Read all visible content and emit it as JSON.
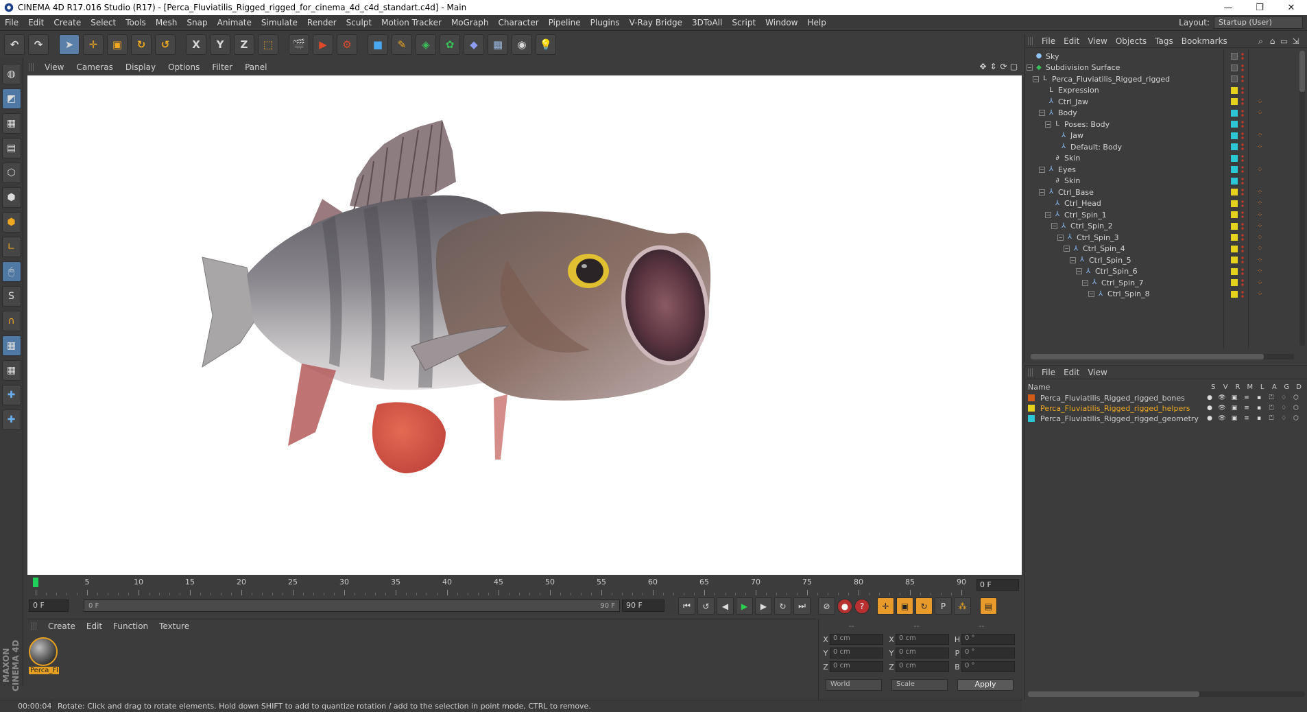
{
  "window": {
    "title": "CINEMA 4D R17.016 Studio (R17) - [Perca_Fluviatilis_Rigged_rigged_for_cinema_4d_c4d_standart.c4d] - Main",
    "minimize": "—",
    "maximize": "❐",
    "close": "✕"
  },
  "menubar": {
    "items": [
      "File",
      "Edit",
      "Create",
      "Select",
      "Tools",
      "Mesh",
      "Snap",
      "Animate",
      "Simulate",
      "Render",
      "Sculpt",
      "Motion Tracker",
      "MoGraph",
      "Character",
      "Pipeline",
      "Plugins",
      "V-Ray Bridge",
      "3DToAll",
      "Script",
      "Window",
      "Help"
    ],
    "layout_label": "Layout:",
    "layout_value": "Startup (User)"
  },
  "toolbar": {
    "icons": [
      "undo-icon",
      "redo-icon",
      "select-icon",
      "move-icon",
      "scale-icon",
      "rotate-icon",
      "recent-icon",
      "x-axis-icon",
      "y-axis-icon",
      "z-axis-icon",
      "world-coord-icon",
      "render-view-icon",
      "render-picture-icon",
      "render-settings-icon",
      "cube-icon",
      "pen-icon",
      "subdivision-icon",
      "cloner-icon",
      "deformer-icon",
      "floor-icon",
      "camera-icon",
      "light-icon"
    ],
    "x": "X",
    "y": "Y",
    "z": "Z"
  },
  "viewport": {
    "menu": [
      "View",
      "Cameras",
      "Display",
      "Options",
      "Filter",
      "Panel"
    ]
  },
  "timeline": {
    "ticks": [
      "0",
      "5",
      "10",
      "15",
      "20",
      "25",
      "30",
      "35",
      "40",
      "45",
      "50",
      "55",
      "60",
      "65",
      "70",
      "75",
      "80",
      "85",
      "90"
    ],
    "current_frame": "0 F"
  },
  "playback": {
    "start_field": "0 F",
    "range_start": "0 F",
    "range_end": "90 F",
    "end_field": "90 F"
  },
  "material_manager": {
    "menu": [
      "Create",
      "Edit",
      "Function",
      "Texture"
    ],
    "material_name": "Perca_Fl"
  },
  "maxon_logo": "MAXON CINEMA 4D",
  "coordinates": {
    "headers": [
      "--",
      "--",
      "--"
    ],
    "rows": [
      {
        "a": "X",
        "av": "0 cm",
        "b": "X",
        "bv": "0 cm",
        "c": "H",
        "cv": "0 °"
      },
      {
        "a": "Y",
        "av": "0 cm",
        "b": "Y",
        "bv": "0 cm",
        "c": "P",
        "cv": "0 °"
      },
      {
        "a": "Z",
        "av": "0 cm",
        "b": "Z",
        "bv": "0 cm",
        "c": "B",
        "cv": "0 °"
      }
    ],
    "space": "World",
    "mode": "Scale",
    "apply": "Apply"
  },
  "statusbar": {
    "time": "00:00:04",
    "message": "Rotate: Click and drag to rotate elements. Hold down SHIFT to add to quantize rotation / add to the selection in point mode, CTRL to remove."
  },
  "object_manager": {
    "menu": [
      "File",
      "Edit",
      "View",
      "Objects",
      "Tags",
      "Bookmarks"
    ],
    "objects": [
      {
        "name": "Sky",
        "depth": 0,
        "icon": "sky",
        "color": "none"
      },
      {
        "name": "Subdivision Surface",
        "depth": 0,
        "icon": "subdiv",
        "color": "none"
      },
      {
        "name": "Perca_Fluviatilis_Rigged_rigged",
        "depth": 1,
        "icon": "null",
        "color": "none"
      },
      {
        "name": "Expression",
        "depth": 2,
        "icon": "null",
        "color": "yellow"
      },
      {
        "name": "Ctrl_Jaw",
        "depth": 2,
        "icon": "joint",
        "color": "yellow"
      },
      {
        "name": "Body",
        "depth": 2,
        "icon": "joint",
        "color": "cyan"
      },
      {
        "name": "Poses: Body",
        "depth": 3,
        "icon": "null",
        "color": "cyan"
      },
      {
        "name": "Jaw",
        "depth": 4,
        "icon": "joint",
        "color": "cyan"
      },
      {
        "name": "Default: Body",
        "depth": 4,
        "icon": "joint",
        "color": "cyan"
      },
      {
        "name": "Skin",
        "depth": 3,
        "icon": "skin",
        "color": "cyan"
      },
      {
        "name": "Eyes",
        "depth": 2,
        "icon": "joint",
        "color": "cyan"
      },
      {
        "name": "Skin",
        "depth": 3,
        "icon": "skin",
        "color": "cyan"
      },
      {
        "name": "Ctrl_Base",
        "depth": 2,
        "icon": "joint",
        "color": "yellow"
      },
      {
        "name": "Ctrl_Head",
        "depth": 3,
        "icon": "joint",
        "color": "yellow"
      },
      {
        "name": "Ctrl_Spin_1",
        "depth": 3,
        "icon": "joint",
        "color": "yellow"
      },
      {
        "name": "Ctrl_Spin_2",
        "depth": 4,
        "icon": "joint",
        "color": "yellow"
      },
      {
        "name": "Ctrl_Spin_3",
        "depth": 5,
        "icon": "joint",
        "color": "yellow"
      },
      {
        "name": "Ctrl_Spin_4",
        "depth": 6,
        "icon": "joint",
        "color": "yellow"
      },
      {
        "name": "Ctrl_Spin_5",
        "depth": 7,
        "icon": "joint",
        "color": "yellow"
      },
      {
        "name": "Ctrl_Spin_6",
        "depth": 8,
        "icon": "joint",
        "color": "yellow"
      },
      {
        "name": "Ctrl_Spin_7",
        "depth": 9,
        "icon": "joint",
        "color": "yellow"
      },
      {
        "name": "Ctrl_Spin_8",
        "depth": 10,
        "icon": "joint",
        "color": "yellow"
      }
    ]
  },
  "layer_manager": {
    "menu": [
      "File",
      "Edit",
      "View"
    ],
    "columns": [
      "Name",
      "S",
      "V",
      "R",
      "M",
      "L",
      "A",
      "G",
      "D"
    ],
    "layers": [
      {
        "name": "Perca_Fluviatilis_Rigged_rigged_bones",
        "color": "#d35c1a",
        "highlight": false
      },
      {
        "name": "Perca_Fluviatilis_Rigged_rigged_helpers",
        "color": "#e6d21e",
        "highlight": true
      },
      {
        "name": "Perca_Fluviatilis_Rigged_rigged_geometry",
        "color": "#2cc6d6",
        "highlight": false
      }
    ]
  },
  "colors": {
    "yellow": "#e6d21e",
    "cyan": "#2cc6d6",
    "accent": "#e8a020",
    "play": "#2ad14e"
  }
}
